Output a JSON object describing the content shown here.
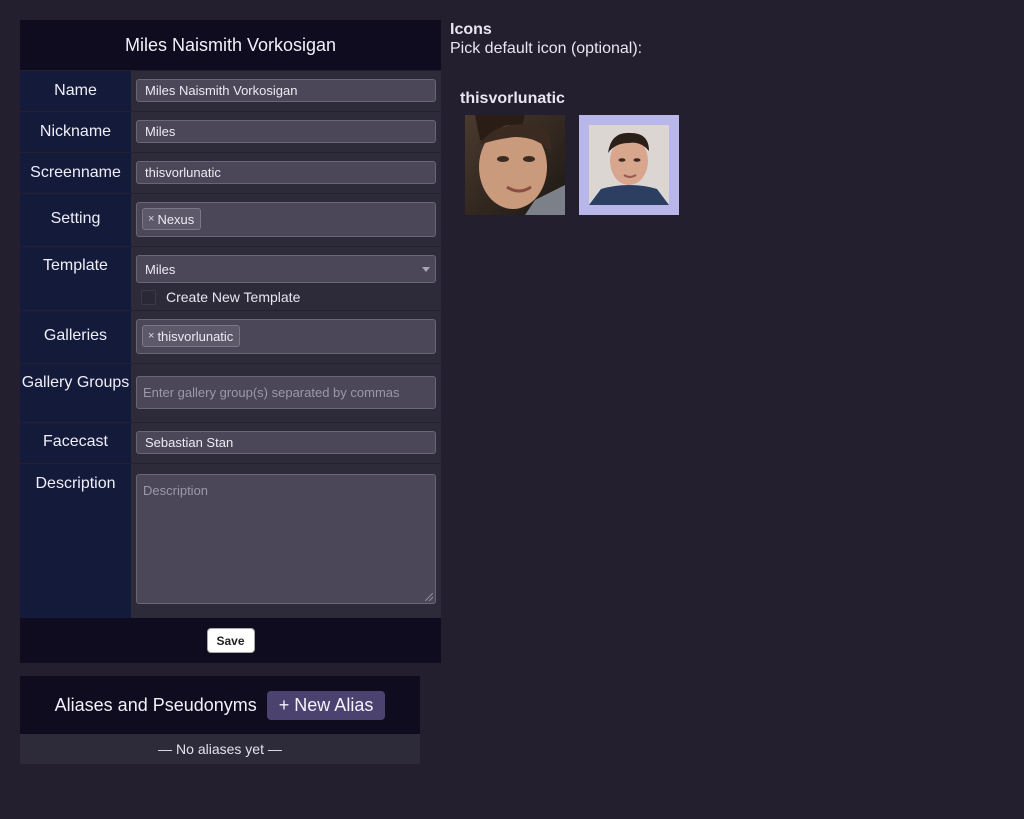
{
  "form": {
    "title": "Miles Naismith Vorkosigan",
    "name_label": "Name",
    "name_value": "Miles Naismith Vorkosigan",
    "nickname_label": "Nickname",
    "nickname_value": "Miles",
    "screenname_label": "Screenname",
    "screenname_value": "thisvorlunatic",
    "setting_label": "Setting",
    "setting_tags": [
      "Nexus"
    ],
    "template_label": "Template",
    "template_selected": "Miles",
    "create_template_label": "Create New Template",
    "galleries_label": "Galleries",
    "gallery_tags": [
      "thisvorlunatic"
    ],
    "gallery_groups_label": "Gallery Groups",
    "gallery_groups_placeholder": "Enter gallery group(s) separated by commas",
    "facecast_label": "Facecast",
    "facecast_value": "Sebastian Stan",
    "description_label": "Description",
    "description_placeholder": "Description",
    "save_label": "Save",
    "tag_remove_glyph": "×"
  },
  "aliases": {
    "title": "Aliases and Pseudonyms",
    "new_alias_label": "+ New Alias",
    "empty_text": "— No aliases yet —"
  },
  "icons": {
    "title": "Icons",
    "subtitle": "Pick default icon (optional):",
    "gallery_name": "thisvorlunatic",
    "thumbnails": [
      {
        "name": "icon-thumb-1",
        "selected": false
      },
      {
        "name": "icon-thumb-2",
        "selected": true
      }
    ]
  },
  "colors": {
    "page_bg": "#231f2f",
    "header_bg": "#0e0c1e",
    "label_bg": "#131a3a",
    "field_bg": "#2d2a3a",
    "accent": "#4c4270",
    "selected_icon_border": "#b9b6ea"
  }
}
